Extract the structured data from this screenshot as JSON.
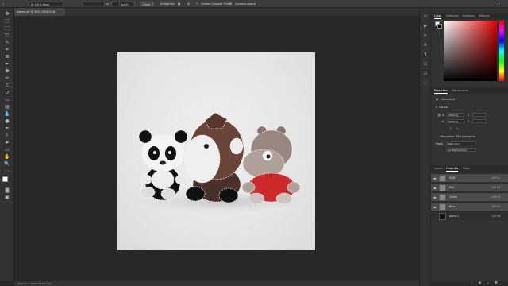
{
  "options_bar": {
    "ratio": "W x H x Reso",
    "field_w": "",
    "field_h": "",
    "unit": "px/in",
    "clear": "Clear",
    "straighten": "Straighten",
    "delete_cropped": "Delete Cropped Pixels",
    "content_aware": "Content-Aware"
  },
  "document": {
    "tab_title": "Rajesh.tif @ 50% (RGB/16#)"
  },
  "status_bar": {
    "text": "3000 px x 3000 px (300 ppi)"
  },
  "panels": {
    "color_tabs": [
      "Color",
      "Swatches",
      "Gradients",
      "Patterns"
    ],
    "props_tabs": [
      "Properties",
      "Adjustments"
    ],
    "props": {
      "doc_label": "Document",
      "canvas_label": "Canvas",
      "w_value": "3000 px",
      "h_value": "3000 px",
      "x_label": "X",
      "y_label": "Y",
      "resolution": "Resolution: 300 pixels/inch",
      "mode_label": "Mode",
      "mode_value": "RGB Color",
      "bits_value": "16 Bits/Channel"
    },
    "channel_tabs": [
      "Layers",
      "Channels",
      "Paths"
    ],
    "channels": [
      {
        "name": "RGB",
        "key": "Ctrl+2"
      },
      {
        "name": "Red",
        "key": "Ctrl+3"
      },
      {
        "name": "Green",
        "key": "Ctrl+4"
      },
      {
        "name": "Blue",
        "key": "Ctrl+5"
      },
      {
        "name": "Alpha 1",
        "key": "Ctrl+6"
      }
    ]
  },
  "colors": {
    "foreground": "#ffffff",
    "background": "#000000",
    "accent": "#e00000"
  }
}
